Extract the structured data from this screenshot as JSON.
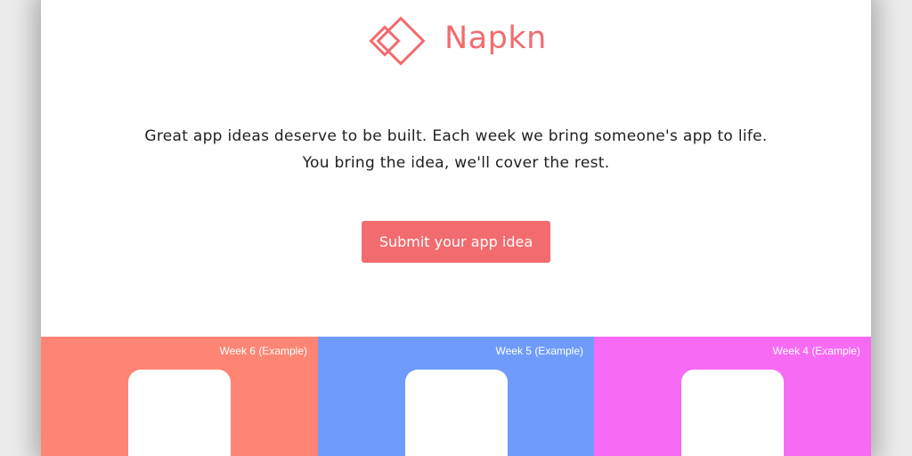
{
  "brand": {
    "name": "Napkn",
    "accent_color": "#f26b6f"
  },
  "hero": {
    "line1": "Great app ideas deserve to be built. Each week we bring someone's app to life.",
    "line2": "You bring the idea, we'll cover the rest.",
    "cta_label": "Submit your app idea"
  },
  "weeks": [
    {
      "label": "Week 6 (Example)",
      "color": "#fe8574"
    },
    {
      "label": "Week 5 (Example)",
      "color": "#6f9cfb"
    },
    {
      "label": "Week 4 (Example)",
      "color": "#f76bf4"
    }
  ]
}
